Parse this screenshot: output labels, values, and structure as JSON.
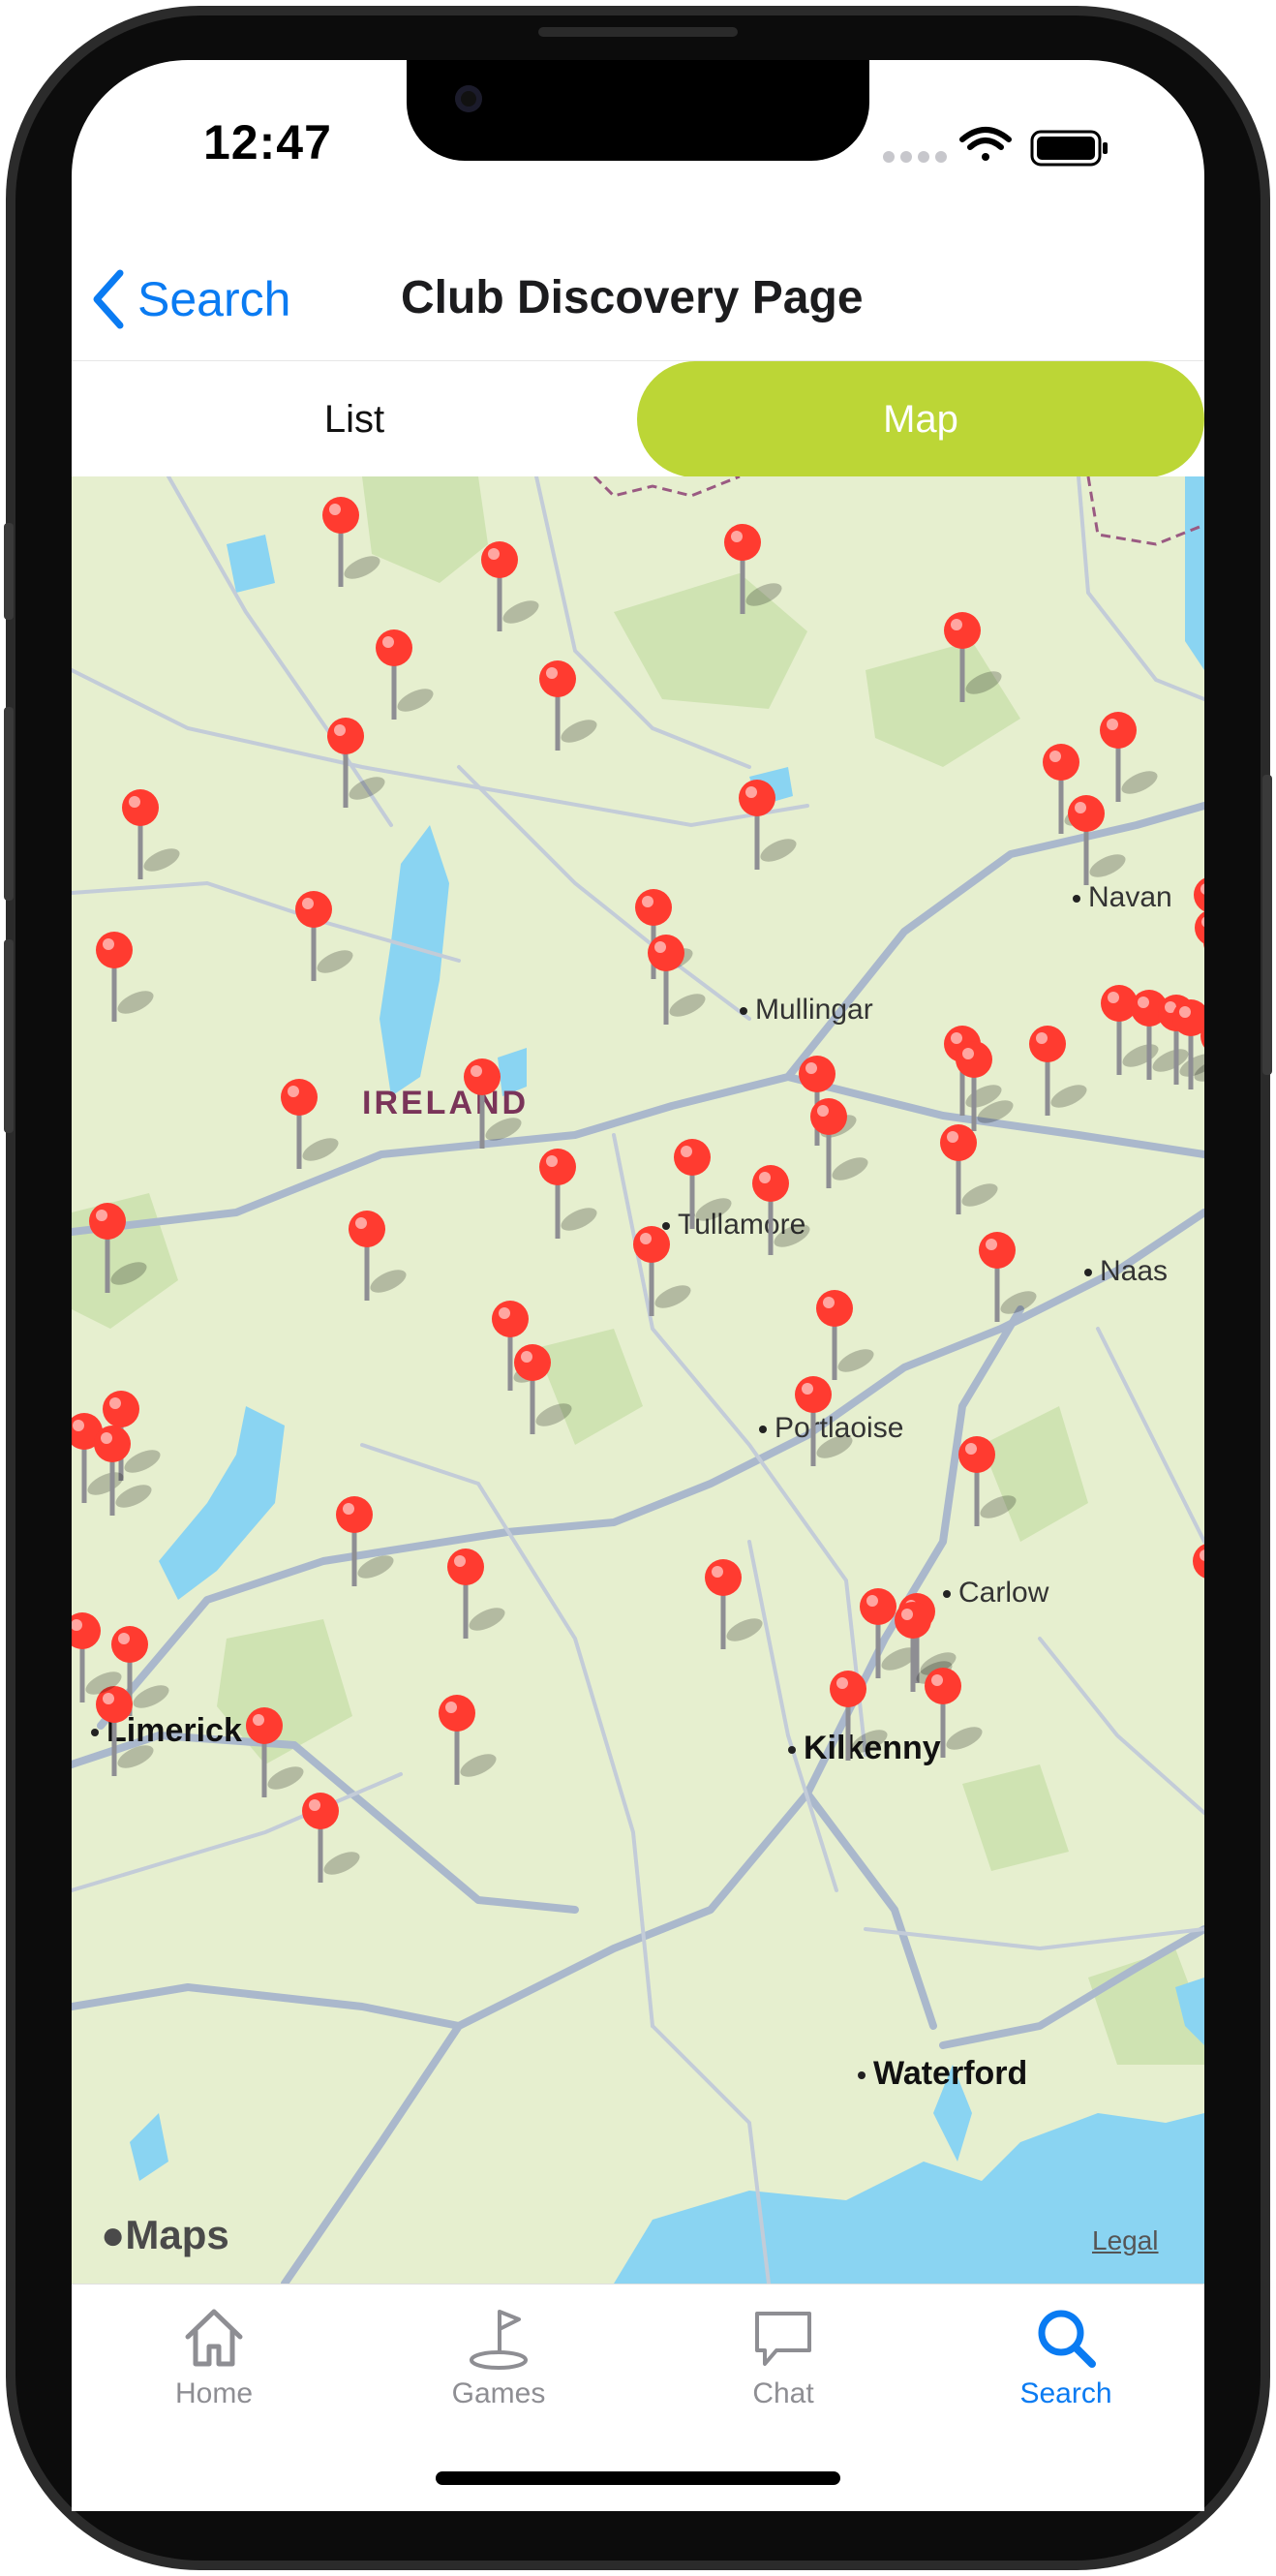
{
  "status": {
    "time": "12:47"
  },
  "nav": {
    "back_label": "Search",
    "title": "Club Discovery Page"
  },
  "segmented": {
    "list_label": "List",
    "map_label": "Map",
    "selected": "Map"
  },
  "map": {
    "country_label": "IRELAND",
    "places": [
      {
        "name": "Mullingar"
      },
      {
        "name": "Navan"
      },
      {
        "name": "Tullamore"
      },
      {
        "name": "Naas"
      },
      {
        "name": "Portlaoise"
      },
      {
        "name": "Carlow"
      },
      {
        "name": "Limerick"
      },
      {
        "name": "Kilkenny"
      },
      {
        "name": "Waterford"
      }
    ],
    "pin_count": 62,
    "attribution": "Maps",
    "legal_label": "Legal"
  },
  "tabs": [
    {
      "label": "Home",
      "icon": "house-icon",
      "active": false
    },
    {
      "label": "Games",
      "icon": "golf-flag-icon",
      "active": false
    },
    {
      "label": "Chat",
      "icon": "chat-bubble-icon",
      "active": false
    },
    {
      "label": "Search",
      "icon": "magnifier-icon",
      "active": true
    }
  ],
  "colors": {
    "accent": "#0a7bf2",
    "segment_active": "#bcd636",
    "pin": "#ff3b30",
    "water": "#8ad4f2",
    "land": "#e6efcf"
  }
}
